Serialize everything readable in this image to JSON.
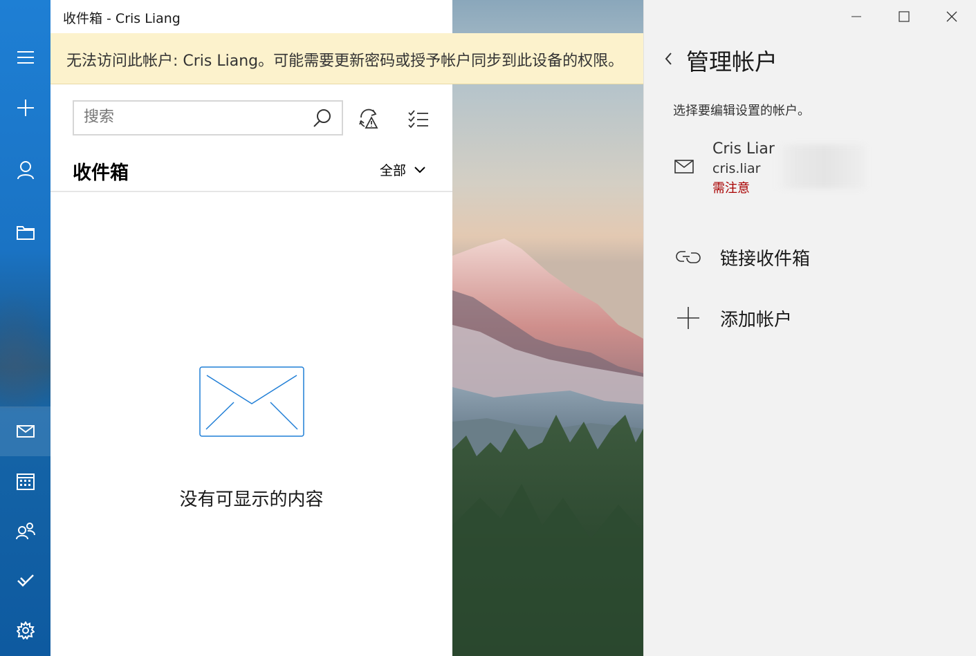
{
  "window": {
    "title": "收件箱 - Cris Liang",
    "controls": {
      "minimize": "minimize",
      "maximize": "maximize",
      "close": "close"
    }
  },
  "banner": {
    "text": "无法访问此帐户: Cris Liang。可能需要更新密码或授予帐户同步到此设备的权限。",
    "bg_color": "#fcf2cc"
  },
  "nav_rail": {
    "items": [
      {
        "icon": "hamburger-menu-icon"
      },
      {
        "icon": "new-mail-plus-icon"
      },
      {
        "icon": "accounts-person-icon"
      },
      {
        "icon": "folders-icon"
      },
      {
        "icon": "mail-icon",
        "active": true
      },
      {
        "icon": "calendar-icon"
      },
      {
        "icon": "people-icon"
      },
      {
        "icon": "todo-check-icon"
      },
      {
        "icon": "settings-gear-icon"
      }
    ],
    "accent": "#1a73c4"
  },
  "list": {
    "search_placeholder": "搜索",
    "folder_title": "收件箱",
    "filter_label": "全部",
    "empty_text": "没有可显示的内容"
  },
  "panel": {
    "title": "管理帐户",
    "subtitle": "选择要编辑设置的帐户。",
    "account": {
      "name": "Cris Liar",
      "email": "cris.liar",
      "status": "需注意",
      "status_color": "#a80000"
    },
    "actions": [
      {
        "icon": "link-icon",
        "label": "链接收件箱"
      },
      {
        "icon": "plus-icon",
        "label": "添加帐户"
      }
    ]
  }
}
